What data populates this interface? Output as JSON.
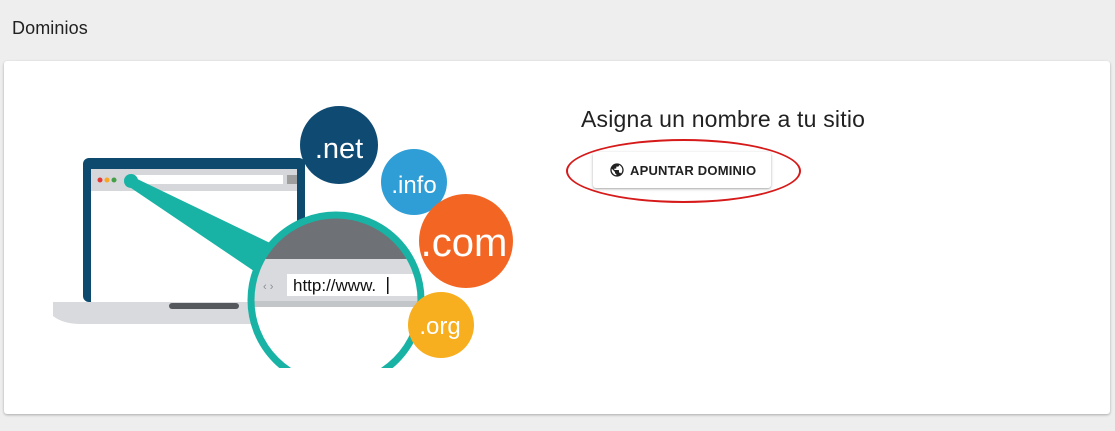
{
  "header": {
    "title": "Dominios"
  },
  "illustration": {
    "address_text": "http://www.",
    "tlds": {
      "net": ".net",
      "info": ".info",
      "com": ".com",
      "org": ".org"
    },
    "colors": {
      "net": "#0f4a72",
      "info": "#2f9ed6",
      "com": "#f36523",
      "org": "#f7ae1f",
      "magnifier": "#18b3a4"
    }
  },
  "main": {
    "title": "Asigna un nombre a tu sitio",
    "button_label": "APUNTAR DOMINIO",
    "button_icon": "globe-icon",
    "annotation_color": "#d61a1a"
  }
}
